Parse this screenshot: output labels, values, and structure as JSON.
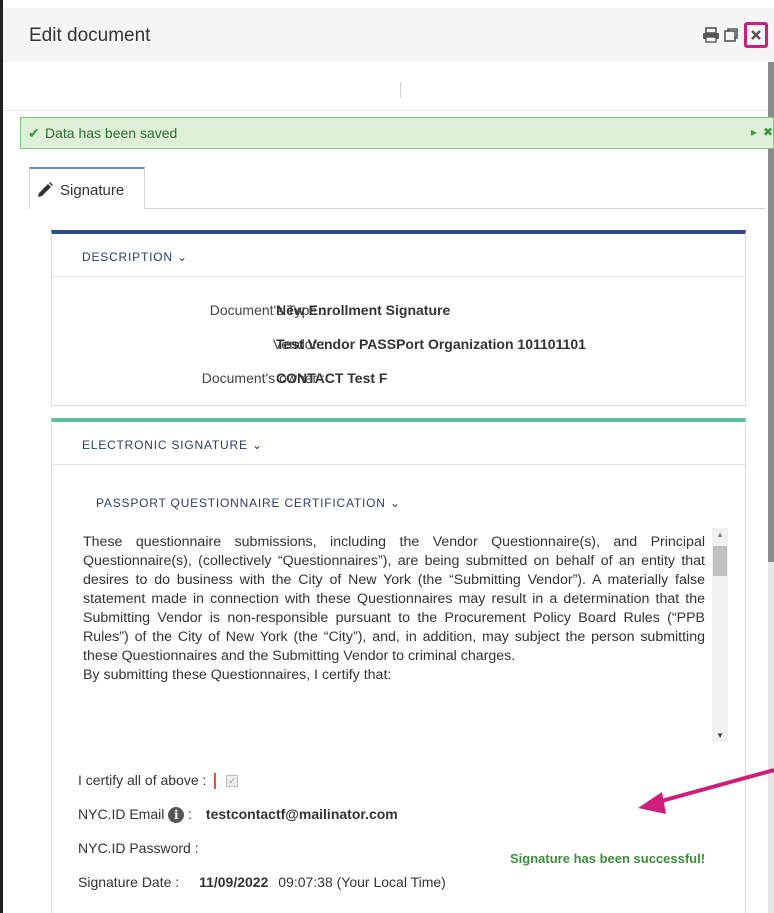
{
  "header": {
    "title": "Edit document",
    "icons": [
      "print-icon",
      "restore-icon",
      "close-icon"
    ]
  },
  "alert": {
    "message": "Data has been saved",
    "status_color": "#dff0d8"
  },
  "tabs": [
    {
      "label": "Signature",
      "icon": "pencil-icon",
      "active": true
    }
  ],
  "description": {
    "heading": "DESCRIPTION",
    "rows": [
      {
        "label": "Document's Type :",
        "value": "New Enrollment Signature"
      },
      {
        "label": "Vendor :",
        "value": "Test Vendor PASSPort Organization 101101101"
      },
      {
        "label": "Document's owner :",
        "value": "CONTACT Test F"
      }
    ]
  },
  "electronic_signature": {
    "heading": "ELECTRONIC SIGNATURE",
    "certification_heading": "PASSPORT QUESTIONNAIRE CERTIFICATION",
    "certification_text_1": "These questionnaire submissions, including the Vendor Questionnaire(s), and Principal Questionnaire(s), (collectively “Questionnaires”), are being submitted on behalf of an entity that desires to do business with the City of New York (the “Submitting Vendor”). A materially false statement made in connection with these Questionnaires may result in a determination that the Submitting Vendor is non-responsible pursuant to the Procurement Policy Board Rules (“PPB Rules”) of the City of New York (the “City”), and, in addition, may subject the person submitting these Questionnaires and the Submitting Vendor to criminal charges.",
    "certification_text_2": "By submitting these Questionnaires, I certify that:",
    "fields": {
      "certify_label": "I certify all of above :",
      "certify_checked": true,
      "email_label": "NYC.ID Email",
      "email_colon": ":",
      "email_value": "testcontactf@mailinator.com",
      "password_label": "NYC.ID Password :",
      "date_label": "Signature Date :",
      "date_value": "11/09/2022",
      "time_value": "09:07:38 (Your Local Time)"
    },
    "success_message": "Signature has been successful!"
  },
  "colors": {
    "description_accent": "#2d4a8a",
    "signature_accent": "#5cbf9a",
    "success_text": "#3a8f3a",
    "annotation_arrow": "#d01c7a"
  }
}
